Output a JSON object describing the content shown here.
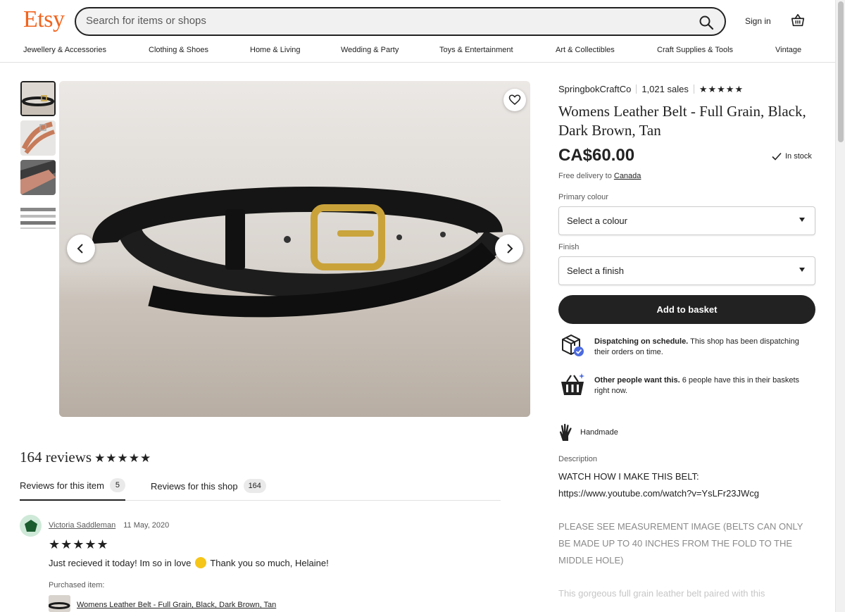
{
  "header": {
    "logo": "Etsy",
    "search_placeholder": "Search for items or shops",
    "sign_in": "Sign in"
  },
  "nav": {
    "items": [
      "Jewellery & Accessories",
      "Clothing & Shoes",
      "Home & Living",
      "Wedding & Party",
      "Toys & Entertainment",
      "Art & Collectibles",
      "Craft Supplies & Tools",
      "Vintage"
    ]
  },
  "listing": {
    "shop_name": "SpringbokCraftCo",
    "sales": "1,021 sales",
    "shop_rating_stars": "★★★★★",
    "title": "Womens Leather Belt - Full Grain, Black, Dark Brown, Tan",
    "price": "CA$60.00",
    "stock": "In stock",
    "delivery_prefix": "Free delivery to",
    "delivery_country": "Canada",
    "primary_colour_label": "Primary colour",
    "primary_colour_value": "Select a colour",
    "finish_label": "Finish",
    "finish_value": "Select a finish",
    "add_to_basket": "Add to basket",
    "dispatch_title": "Dispatching on schedule.",
    "dispatch_text": "This shop has been dispatching their orders on time.",
    "demand_title": "Other people want this.",
    "demand_text": "6 people have this in their baskets right now.",
    "handmade": "Handmade",
    "description_label": "Description",
    "description_line1": "WATCH HOW I MAKE THIS BELT:",
    "description_line2": "https://www.youtube.com/watch?v=YsLFr23JWcg",
    "description_line3": "PLEASE SEE MEASUREMENT IMAGE (BELTS CAN ONLY BE MADE UP TO 40 INCHES FROM THE FOLD TO THE MIDDLE HOLE)",
    "description_line4": "This gorgeous full grain leather belt paired with this"
  },
  "reviews": {
    "heading": "164 reviews",
    "stars": "★★★★★",
    "tab_item_label": "Reviews for this item",
    "tab_item_count": "5",
    "tab_shop_label": "Reviews for this shop",
    "tab_shop_count": "164",
    "review": {
      "author": "Victoria Saddleman",
      "date": "11 May, 2020",
      "stars": "★★★★★",
      "text_before": "Just recieved it today! Im so in love",
      "text_after": "Thank you so much, Helaine!",
      "purchased_label": "Purchased item:",
      "purchased_item": "Womens Leather Belt - Full Grain, Black, Dark Brown, Tan"
    }
  },
  "icons": {
    "search": "search-icon",
    "basket": "basket-icon",
    "heart": "heart-icon",
    "prev": "chevron-left-icon",
    "next": "chevron-right-icon",
    "check": "check-icon",
    "dispatch": "box-check-icon",
    "demand": "shopping-basket-icon",
    "handmade": "hand-icon"
  },
  "colors": {
    "brand": "#f1641e",
    "button": "#222222",
    "badge": "#eaeaea"
  }
}
